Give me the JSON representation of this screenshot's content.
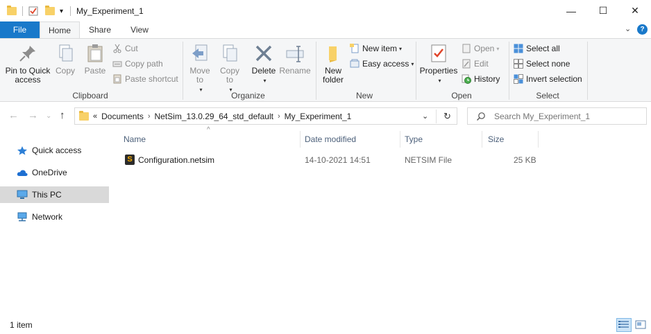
{
  "window": {
    "title": "My_Experiment_1",
    "minimize": "—",
    "maximize": "☐",
    "close": "✕"
  },
  "ribbon_tabs": {
    "file": "File",
    "home": "Home",
    "share": "Share",
    "view": "View"
  },
  "ribbon": {
    "clipboard": {
      "label": "Clipboard",
      "pin": "Pin to Quick access",
      "copy": "Copy",
      "paste": "Paste",
      "cut": "Cut",
      "copy_path": "Copy path",
      "paste_shortcut": "Paste shortcut"
    },
    "organize": {
      "label": "Organize",
      "move_to": "Move to",
      "copy_to": "Copy to",
      "delete": "Delete",
      "rename": "Rename"
    },
    "new": {
      "label": "New",
      "new_folder": "New folder",
      "new_item": "New item",
      "easy_access": "Easy access"
    },
    "open": {
      "label": "Open",
      "properties": "Properties",
      "open": "Open",
      "edit": "Edit",
      "history": "History"
    },
    "select": {
      "label": "Select",
      "select_all": "Select all",
      "select_none": "Select none",
      "invert_selection": "Invert selection"
    }
  },
  "address": {
    "overflow": "«",
    "crumbs": [
      "Documents",
      "NetSim_13.0.29_64_std_default",
      "My_Experiment_1"
    ],
    "refresh": "↻"
  },
  "search": {
    "placeholder": "Search My_Experiment_1"
  },
  "nav": {
    "items": [
      {
        "label": "Quick access"
      },
      {
        "label": "OneDrive"
      },
      {
        "label": "This PC"
      },
      {
        "label": "Network"
      }
    ]
  },
  "list": {
    "columns": [
      "Name",
      "Date modified",
      "Type",
      "Size"
    ],
    "rows": [
      {
        "name": "Configuration.netsim",
        "date": "14-10-2021 14:51",
        "type": "NETSIM File",
        "size": "25 KB"
      }
    ]
  },
  "status": {
    "count": "1 item"
  }
}
